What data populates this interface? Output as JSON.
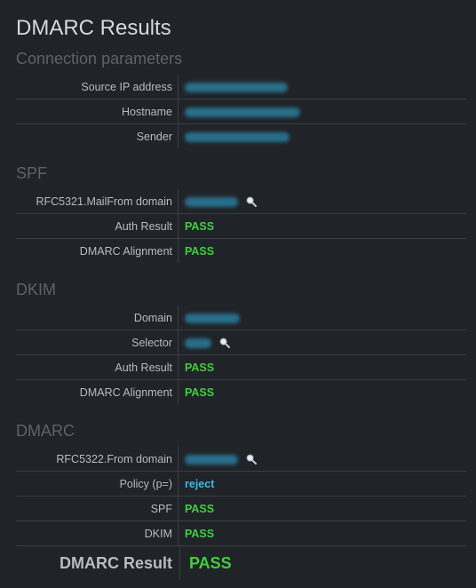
{
  "title": "DMARC Results",
  "connection": {
    "heading": "Connection parameters",
    "source_ip_label": "Source IP address",
    "hostname_label": "Hostname",
    "sender_label": "Sender"
  },
  "spf": {
    "heading": "SPF",
    "mailfrom_label": "RFC5321.MailFrom domain",
    "auth_label": "Auth Result",
    "auth_value": "PASS",
    "alignment_label": "DMARC Alignment",
    "alignment_value": "PASS"
  },
  "dkim": {
    "heading": "DKIM",
    "domain_label": "Domain",
    "selector_label": "Selector",
    "auth_label": "Auth Result",
    "auth_value": "PASS",
    "alignment_label": "DMARC Alignment",
    "alignment_value": "PASS"
  },
  "dmarc": {
    "heading": "DMARC",
    "from_label": "RFC5322.From domain",
    "policy_label": "Policy (p=)",
    "policy_value": "reject",
    "spf_label": "SPF",
    "spf_value": "PASS",
    "dkim_label": "DKIM",
    "dkim_value": "PASS",
    "result_label": "DMARC Result",
    "result_value": "PASS"
  },
  "colors": {
    "pass": "#3fcf3f",
    "policy": "#3cb8ef",
    "redacted": "#2a7c9c"
  },
  "icons": {
    "lookup": "magnifier-icon",
    "redacted": "redacted-value"
  }
}
